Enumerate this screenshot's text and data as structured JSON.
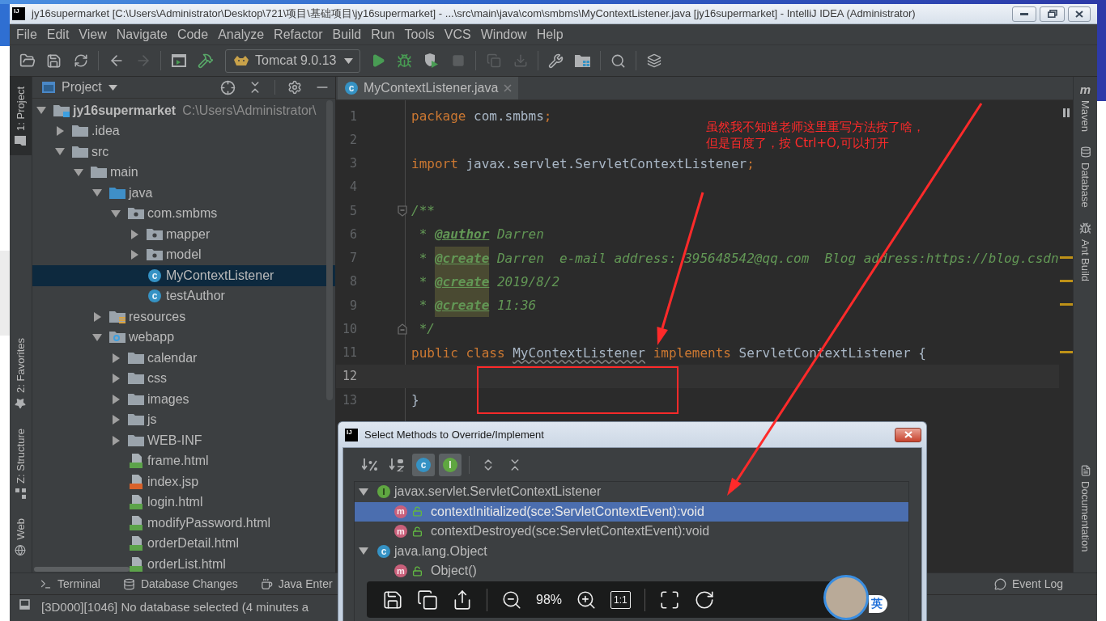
{
  "window": {
    "logo": "IJ",
    "title": "jy16supermarket [C:\\Users\\Administrator\\Desktop\\721\\项目\\基础项目\\jy16supermarket] - ...\\src\\main\\java\\com\\smbms\\MyContextListener.java [jy16supermarket] - IntelliJ IDEA (Administrator)"
  },
  "menu": [
    "File",
    "Edit",
    "View",
    "Navigate",
    "Code",
    "Analyze",
    "Refactor",
    "Build",
    "Run",
    "Tools",
    "VCS",
    "Window",
    "Help"
  ],
  "toolbar": [
    {
      "kind": "open",
      "disabled": false
    },
    {
      "kind": "save",
      "disabled": false
    },
    {
      "kind": "sync",
      "disabled": false
    },
    {
      "kind": "separator"
    },
    {
      "kind": "back",
      "disabled": false
    },
    {
      "kind": "forward",
      "disabled": true
    },
    {
      "kind": "separator"
    },
    {
      "kind": "frame",
      "disabled": false
    },
    {
      "kind": "build",
      "disabled": false
    },
    {
      "kind": "run_config",
      "label": "Tomcat 9.0.13"
    },
    {
      "kind": "run",
      "disabled": false
    },
    {
      "kind": "debug",
      "disabled": false
    },
    {
      "kind": "coverage",
      "disabled": false
    },
    {
      "kind": "stop",
      "disabled": true
    },
    {
      "kind": "separator"
    },
    {
      "kind": "update",
      "disabled": true
    },
    {
      "kind": "deploy",
      "disabled": true
    },
    {
      "kind": "separator"
    },
    {
      "kind": "settings",
      "disabled": false
    },
    {
      "kind": "structure",
      "disabled": false
    },
    {
      "kind": "separator"
    },
    {
      "kind": "search",
      "disabled": false
    },
    {
      "kind": "separator"
    },
    {
      "kind": "layout",
      "disabled": false
    }
  ],
  "left_tool_strip": {
    "top": [
      {
        "label": "1: Project",
        "kind": "project",
        "selected": true
      }
    ],
    "bottom": [
      {
        "label": "2: Favorites",
        "kind": "favorites",
        "selected": false
      },
      {
        "label": "Z: Structure",
        "kind": "structure",
        "selected": false
      },
      {
        "label": "Web",
        "kind": "web",
        "selected": false
      }
    ]
  },
  "project_panel": {
    "title": "Project",
    "tree": [
      {
        "label": "jy16supermarket",
        "path": "C:\\Users\\Administrator\\",
        "kind": "module",
        "expanded": true,
        "selected": false,
        "children": [
          {
            "label": ".idea",
            "kind": "folder",
            "expanded": false,
            "selected": false
          },
          {
            "label": "src",
            "kind": "folder",
            "expanded": true,
            "selected": false,
            "children": [
              {
                "label": "main",
                "kind": "folder",
                "expanded": true,
                "selected": false,
                "children": [
                  {
                    "label": "java",
                    "kind": "source_folder",
                    "expanded": true,
                    "selected": false,
                    "children": [
                      {
                        "label": "com.smbms",
                        "kind": "package",
                        "expanded": true,
                        "selected": false,
                        "children": [
                          {
                            "label": "mapper",
                            "kind": "package",
                            "expanded": false,
                            "selected": false
                          },
                          {
                            "label": "model",
                            "kind": "package",
                            "expanded": false,
                            "selected": false
                          },
                          {
                            "label": "MyContextListener",
                            "kind": "class",
                            "icon": "c",
                            "selected": true
                          },
                          {
                            "label": "testAuthor",
                            "kind": "class",
                            "icon": "c",
                            "selected": false
                          }
                        ]
                      }
                    ]
                  },
                  {
                    "label": "resources",
                    "kind": "resources_folder",
                    "expanded": false,
                    "selected": false
                  },
                  {
                    "label": "webapp",
                    "kind": "web_folder",
                    "expanded": true,
                    "selected": false,
                    "children": [
                      {
                        "label": "calendar",
                        "kind": "folder",
                        "expanded": false,
                        "selected": false
                      },
                      {
                        "label": "css",
                        "kind": "folder",
                        "expanded": false,
                        "selected": false
                      },
                      {
                        "label": "images",
                        "kind": "folder",
                        "expanded": false,
                        "selected": false
                      },
                      {
                        "label": "js",
                        "kind": "folder",
                        "expanded": false,
                        "selected": false
                      },
                      {
                        "label": "WEB-INF",
                        "kind": "folder",
                        "expanded": false,
                        "selected": false
                      },
                      {
                        "label": "frame.html",
                        "kind": "html",
                        "selected": false
                      },
                      {
                        "label": "index.jsp",
                        "kind": "jsp",
                        "selected": false
                      },
                      {
                        "label": "login.html",
                        "kind": "html",
                        "selected": false
                      },
                      {
                        "label": "modifyPassword.html",
                        "kind": "html",
                        "selected": false
                      },
                      {
                        "label": "orderDetail.html",
                        "kind": "html",
                        "selected": false
                      },
                      {
                        "label": "orderList.html",
                        "kind": "html",
                        "selected": false
                      }
                    ]
                  }
                ]
              }
            ]
          }
        ]
      }
    ]
  },
  "editor": {
    "tab": {
      "label": "MyContextListener.java",
      "icon": "c",
      "selected": true
    },
    "lines": [
      {
        "number": "1",
        "current": false,
        "warning": false,
        "tokens": [
          {
            "text": "package",
            "kind": "keyword"
          },
          {
            "text": " com.smbms",
            "kind": "plain"
          },
          {
            "text": ";",
            "kind": "keyword"
          }
        ]
      },
      {
        "number": "2",
        "current": false,
        "warning": false
      },
      {
        "number": "3",
        "current": false,
        "warning": false,
        "tokens": [
          {
            "text": "import",
            "kind": "keyword"
          },
          {
            "text": " javax.servlet.ServletContextListener",
            "kind": "plain"
          },
          {
            "text": ";",
            "kind": "keyword"
          }
        ]
      },
      {
        "number": "4",
        "current": false,
        "warning": false
      },
      {
        "number": "5",
        "current": false,
        "warning": false,
        "fold_start": true,
        "tokens": [
          {
            "text": "/**",
            "kind": "comment"
          }
        ]
      },
      {
        "number": "6",
        "current": false,
        "warning": false,
        "tokens": [
          {
            "text": " * ",
            "kind": "comment"
          },
          {
            "text": "@author",
            "kind": "doc_tag"
          },
          {
            "text": " Darren",
            "kind": "comment"
          }
        ]
      },
      {
        "number": "7",
        "current": false,
        "warning": true,
        "tokens": [
          {
            "text": " * ",
            "kind": "comment"
          },
          {
            "text": "@create",
            "kind": "doc_tag_unknown"
          },
          {
            "text": " Darren  e-mail address: 395648542@qq.com  Blog address:https://blog.csdn",
            "kind": "comment"
          }
        ]
      },
      {
        "number": "8",
        "current": false,
        "warning": true,
        "tokens": [
          {
            "text": " * ",
            "kind": "comment"
          },
          {
            "text": "@create",
            "kind": "doc_tag_unknown"
          },
          {
            "text": " 2019/8/2",
            "kind": "comment"
          }
        ]
      },
      {
        "number": "9",
        "current": false,
        "warning": true,
        "tokens": [
          {
            "text": " * ",
            "kind": "comment"
          },
          {
            "text": "@create",
            "kind": "doc_tag_unknown"
          },
          {
            "text": " 11:36",
            "kind": "comment"
          }
        ]
      },
      {
        "number": "10",
        "current": false,
        "warning": false,
        "fold_end": true,
        "tokens": [
          {
            "text": " */",
            "kind": "comment"
          }
        ]
      },
      {
        "number": "11",
        "current": false,
        "warning": true,
        "tokens": [
          {
            "text": "public class ",
            "kind": "keyword"
          },
          {
            "text": "MyContextListener",
            "kind": "class_warning"
          },
          {
            "text": " implements",
            "kind": "keyword"
          },
          {
            "text": " ServletContextListener {",
            "kind": "plain"
          }
        ]
      },
      {
        "number": "12",
        "current": true,
        "warning": false
      },
      {
        "number": "13",
        "current": false,
        "warning": false,
        "tokens": [
          {
            "text": "}",
            "kind": "plain"
          }
        ]
      }
    ]
  },
  "right_tool_strip": {
    "top": [
      {
        "label": "Maven",
        "kind": "maven",
        "icon": "m"
      },
      {
        "label": "Database",
        "kind": "database"
      },
      {
        "label": "Ant Build",
        "kind": "ant"
      }
    ],
    "bottom": [
      {
        "label": "Documentation",
        "kind": "documentation"
      }
    ]
  },
  "bottom_tools": {
    "left": [
      {
        "label": "Terminal",
        "kind": "terminal"
      },
      {
        "label": "Database Changes",
        "kind": "database_changes"
      },
      {
        "label": "Java Enter",
        "kind": "java_enterprise"
      }
    ],
    "right": [
      {
        "label": "Event Log",
        "kind": "event_log"
      }
    ]
  },
  "status_bar": {
    "message": "[3D000][1046] No database selected (4 minutes a"
  },
  "dialog": {
    "logo": "IJ",
    "title": "Select Methods to Override/Implement",
    "tools": [
      {
        "kind": "sort_visibility",
        "on": false
      },
      {
        "kind": "sort_alpha",
        "on": false
      },
      {
        "kind": "show_classes",
        "icon": "c",
        "on": true
      },
      {
        "kind": "show_interfaces",
        "icon": "I",
        "on": true
      },
      {
        "kind": "separator"
      },
      {
        "kind": "expand_all"
      },
      {
        "kind": "collapse_all"
      }
    ],
    "tree": [
      {
        "label": "javax.servlet.ServletContextListener",
        "kind": "interface",
        "icon": "I",
        "expanded": true,
        "selected": false,
        "children": [
          {
            "label": "contextInitialized(sce:ServletContextEvent):void",
            "kind": "method",
            "icon": "m",
            "selected": true
          },
          {
            "label": "contextDestroyed(sce:ServletContextEvent):void",
            "kind": "method",
            "icon": "m",
            "selected": false
          }
        ]
      },
      {
        "label": "java.lang.Object",
        "kind": "class",
        "icon": "c",
        "expanded": true,
        "selected": false,
        "children": [
          {
            "label": "Object()",
            "kind": "method",
            "icon": "m",
            "selected": false
          }
        ]
      }
    ]
  },
  "viewer_toolbar": {
    "zoom": "98%",
    "actual_size": "1:1"
  },
  "ime_widget": {
    "label": "英"
  },
  "annotation": {
    "lines": [
      "虽然我不知道老师这里重写方法按了啥，",
      "但是百度了，按 Ctrl+O,可以打开"
    ]
  }
}
